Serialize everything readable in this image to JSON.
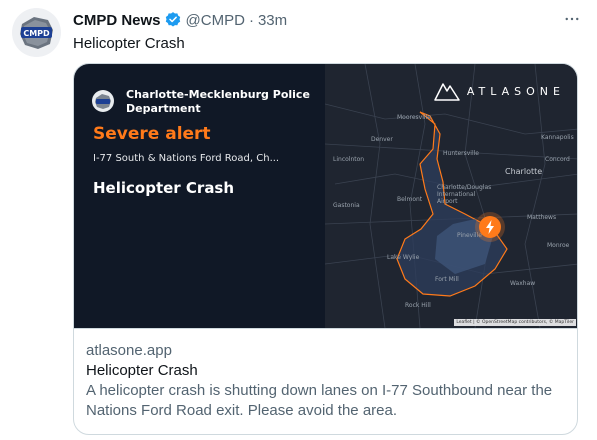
{
  "tweet": {
    "author_name": "CMPD News",
    "handle": "@CMPD",
    "separator": "·",
    "time": "33m",
    "text": "Helicopter Crash",
    "avatar_text": "CMPD"
  },
  "card": {
    "image": {
      "agency": "Charlotte-Mecklenburg Police Department",
      "alert_type": "Severe alert",
      "location": "I-77 South & Nations Ford Road, Ch...",
      "incident": "Helicopter Crash",
      "brand": "ATLASONE",
      "map_labels": {
        "mooresville": "Mooresville",
        "denver": "Denver",
        "concord": "Concord",
        "lincolnton": "Lincolnton",
        "huntersville": "Huntersville",
        "kannapolis": "Kannapolis",
        "charlotte": "Charlotte",
        "gastonia": "Gastonia",
        "belmont": "Belmont",
        "airport": "Charlotte/Douglas International Airport",
        "matthews": "Matthews",
        "pineville": "Pineville",
        "monroe": "Monroe",
        "lake_wylie": "Lake Wylie",
        "fort_mill": "Fort Mill",
        "waxhaw": "Waxhaw",
        "rock_hill": "Rock Hill"
      },
      "attribution": "Leaflet | © OpenStreetMap contributors, © MapTiler"
    },
    "domain": "atlasone.app",
    "title": "Helicopter Crash",
    "description": "A helicopter crash is shutting down lanes on I-77 Southbound near the Nations Ford Road exit. Please avoid the area."
  },
  "colors": {
    "verified": "#1d9bf0",
    "alert_orange": "#ff7a1a",
    "card_dark": "#101826",
    "map_bg": "#1f2530",
    "secondary_text": "#536471"
  },
  "icons": {
    "verified": "verified-badge-icon",
    "more": "more-options-icon",
    "pin": "lightning-bolt-icon"
  }
}
